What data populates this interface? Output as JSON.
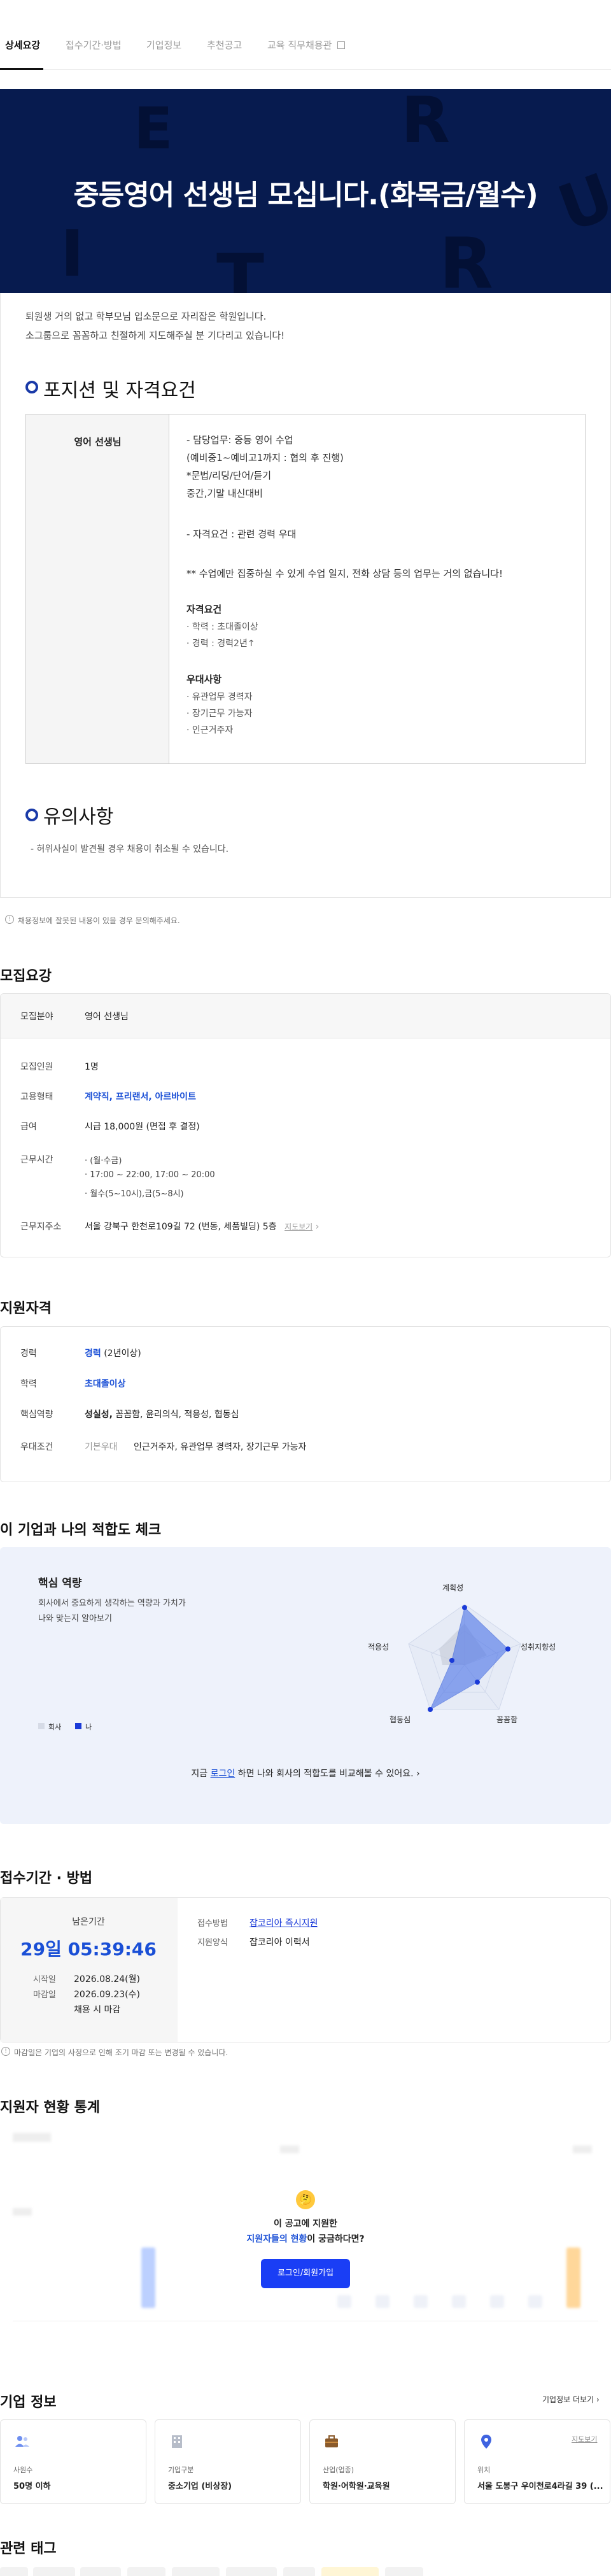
{
  "tabs": [
    "상세요강",
    "접수기간·방법",
    "기업정보",
    "추천공고",
    "교육 직무채용관"
  ],
  "hero": {
    "title": "중등영어 선생님 모십니다.(화목금/월수)"
  },
  "intro": [
    "퇴원생 거의 없고 학부모님 입소문으로 자리잡은 학원입니다.",
    "소그룹으로 꼼꼼하고 친절하게 지도해주실 분 기다리고 있습니다!"
  ],
  "position": {
    "heading": "포지션 및 자격요건",
    "label": "영어 선생님",
    "lines": [
      "- 담당업무: 중등 영어 수업",
      "(예비중1~예비고1까지 : 협의 후 진행)",
      "*문법/리딩/단어/듣기",
      "중간,기말 내신대비",
      "- 자격요건 : 관련 경력 우대",
      "** 수업에만 집중하실 수 있게 수업 일지, 전화 상담 등의 업무는 거의 없습니다!"
    ],
    "req_title": "자격요건",
    "req_items": [
      "· 학력 : 초대졸이상",
      "· 경력 : 경력2년↑"
    ],
    "pref_title": "우대사항",
    "pref_items": [
      "· 유관업무 경력자",
      "· 장기근무 가능자",
      "· 인근거주자"
    ]
  },
  "notice": {
    "heading": "유의사항",
    "text": "- 허위사실이 발견될 경우 채용이 취소될 수 있습니다.",
    "small": "채용정보에 잘못된 내용이 있을 경우 문의해주세요."
  },
  "recruit": {
    "title": "모집요강",
    "field_label": "모집분야",
    "field_value": "영어 선생님",
    "count_label": "모집인원",
    "count_value": "1명",
    "type_label": "고용형태",
    "type_value": "계약직, 프리랜서, 아르바이트",
    "pay_label": "급여",
    "pay_value": "시급 18,000원 (면접 후 결정)",
    "hours_label": "근무시간",
    "hours_lines": [
      "(월·수금)",
      "17:00 ~ 22:00, 17:00 ~ 20:00",
      "월수(5~10시),금(5~8시)"
    ],
    "addr_label": "근무지주소",
    "addr_value": "서울 강북구 한천로109길 72 (번동, 세품빌딩) 5층",
    "map_link": "지도보기"
  },
  "qualification": {
    "title": "지원자격",
    "exp_label": "경력",
    "exp_value": "경력",
    "exp_extra": "(2년이상)",
    "edu_label": "학력",
    "edu_value": "초대졸이상",
    "core_label": "핵심역량",
    "core_bold": "성실성,",
    "core_rest": " 꼼꼼함, 윤리의식, 적응성, 협동심",
    "pref_label": "우대조건",
    "pref_type": "기본우대",
    "pref_value": "인근거주자, 유관업무 경력자, 장기근무 가능자"
  },
  "fit": {
    "title": "이 기업과 나의 적합도 체크",
    "sub_title": "핵심 역량",
    "desc": [
      "회사에서 중요하게 생각하는 역량과 가치가",
      "나와 맞는지 알아보기"
    ],
    "axes": [
      "계획성",
      "성취지향성",
      "꼼꼼함",
      "협동심",
      "적응성"
    ],
    "legend_company": "회사",
    "legend_me": "나",
    "login_pre": "지금 ",
    "login_link": "로그인",
    "login_post": " 하면 나와 회사의 적합도를 비교해볼 수 있어요."
  },
  "apply": {
    "title": "접수기간 · 방법",
    "remain_label": "남은기간",
    "remain_value": "29일 05:39:46",
    "start_label": "시작일",
    "start_value": "2026.08.24(월)",
    "end_label": "마감일",
    "end_value": "2026.09.23(수)",
    "note": "채용 시 마감",
    "method_label": "접수방법",
    "method_value": "잡코리아 즉시지원",
    "form_label": "지원양식",
    "form_value": "잡코리아 이력서",
    "small": "마감일은 기업의 사정으로 인해 조기 마감 또는 변경될 수 있습니다."
  },
  "stats": {
    "title": "지원자 현황 통계",
    "cta_line1": "이 공고에 지원한",
    "cta_line2_blue": "지원자들의 현황",
    "cta_line2_rest": "이 궁금하다면?",
    "cta_button": "로그인/회원가입"
  },
  "company": {
    "title": "기업 정보",
    "more": "기업정보 더보기",
    "cards": [
      {
        "label": "사원수",
        "value": "50명 이하"
      },
      {
        "label": "기업구분",
        "value": "중소기업 (비상장)"
      },
      {
        "label": "산업(업종)",
        "value": "학원·어학원·교육원"
      },
      {
        "label": "위치",
        "value": "서울 도봉구 우이천로4라길 39 (...",
        "link": "지도보기"
      }
    ]
  },
  "tags": {
    "title": "관련 태그"
  },
  "colors": {
    "navy": "#071b4f",
    "accent": "#1a4fd6",
    "button": "#1a3ef5"
  }
}
